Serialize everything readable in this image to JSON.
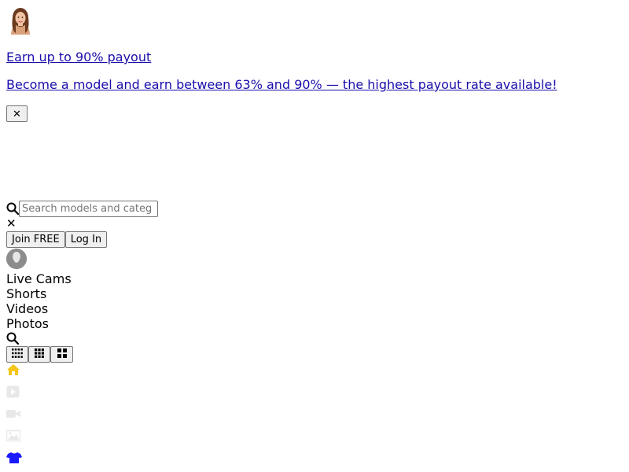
{
  "promo": {
    "headline": "Earn up to 90% payout",
    "subline": "Become a model and earn between 63% and 90% — the highest payout rate available!",
    "close_glyph": "✕"
  },
  "search": {
    "placeholder": "Search models and categ",
    "clear_glyph": "✕"
  },
  "auth": {
    "join_label": "Join FREE",
    "login_label": "Log In"
  },
  "nav": {
    "items": [
      {
        "label": "Live Cams"
      },
      {
        "label": "Shorts"
      },
      {
        "label": "Videos"
      },
      {
        "label": "Photos"
      }
    ]
  },
  "grid_options": [
    "grid-small-icon",
    "grid-medium-icon",
    "grid-large-icon"
  ],
  "sidebar_icons": [
    {
      "name": "home-icon",
      "color": "#f5c518"
    },
    {
      "name": "play-icon",
      "color": "#e8e8e8"
    },
    {
      "name": "camera-icon",
      "color": "#e8e8e8"
    },
    {
      "name": "image-icon",
      "color": "#e8e8e8"
    },
    {
      "name": "shirt-icon",
      "color": "#1a1aff"
    }
  ]
}
